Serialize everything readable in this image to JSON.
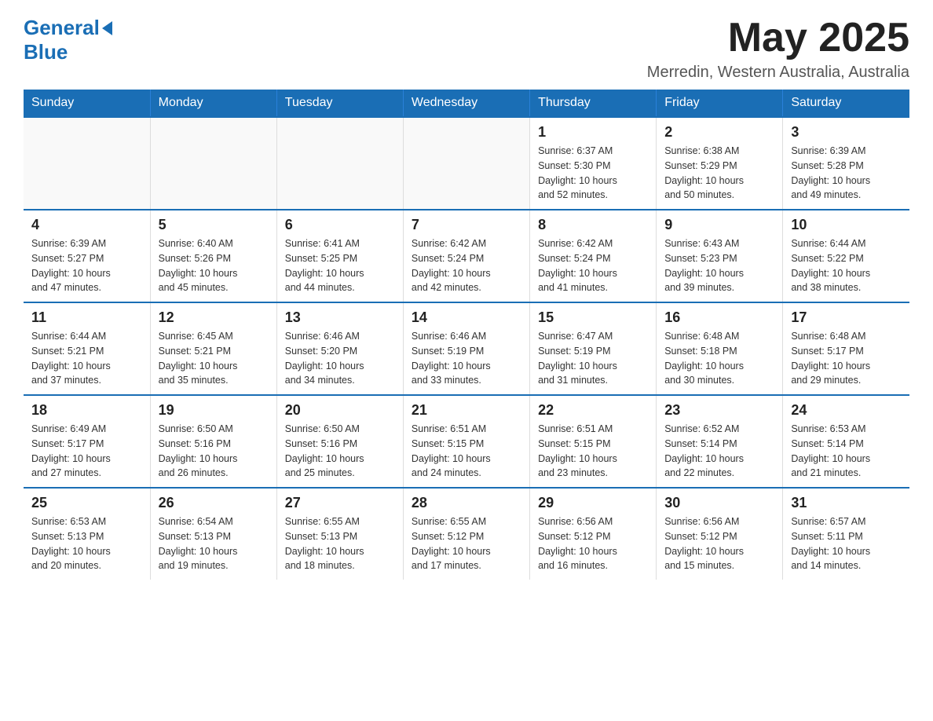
{
  "header": {
    "logo_text1": "General",
    "logo_text2": "Blue",
    "month": "May 2025",
    "location": "Merredin, Western Australia, Australia"
  },
  "weekdays": [
    "Sunday",
    "Monday",
    "Tuesday",
    "Wednesday",
    "Thursday",
    "Friday",
    "Saturday"
  ],
  "weeks": [
    [
      {
        "day": "",
        "info": ""
      },
      {
        "day": "",
        "info": ""
      },
      {
        "day": "",
        "info": ""
      },
      {
        "day": "",
        "info": ""
      },
      {
        "day": "1",
        "info": "Sunrise: 6:37 AM\nSunset: 5:30 PM\nDaylight: 10 hours\nand 52 minutes."
      },
      {
        "day": "2",
        "info": "Sunrise: 6:38 AM\nSunset: 5:29 PM\nDaylight: 10 hours\nand 50 minutes."
      },
      {
        "day": "3",
        "info": "Sunrise: 6:39 AM\nSunset: 5:28 PM\nDaylight: 10 hours\nand 49 minutes."
      }
    ],
    [
      {
        "day": "4",
        "info": "Sunrise: 6:39 AM\nSunset: 5:27 PM\nDaylight: 10 hours\nand 47 minutes."
      },
      {
        "day": "5",
        "info": "Sunrise: 6:40 AM\nSunset: 5:26 PM\nDaylight: 10 hours\nand 45 minutes."
      },
      {
        "day": "6",
        "info": "Sunrise: 6:41 AM\nSunset: 5:25 PM\nDaylight: 10 hours\nand 44 minutes."
      },
      {
        "day": "7",
        "info": "Sunrise: 6:42 AM\nSunset: 5:24 PM\nDaylight: 10 hours\nand 42 minutes."
      },
      {
        "day": "8",
        "info": "Sunrise: 6:42 AM\nSunset: 5:24 PM\nDaylight: 10 hours\nand 41 minutes."
      },
      {
        "day": "9",
        "info": "Sunrise: 6:43 AM\nSunset: 5:23 PM\nDaylight: 10 hours\nand 39 minutes."
      },
      {
        "day": "10",
        "info": "Sunrise: 6:44 AM\nSunset: 5:22 PM\nDaylight: 10 hours\nand 38 minutes."
      }
    ],
    [
      {
        "day": "11",
        "info": "Sunrise: 6:44 AM\nSunset: 5:21 PM\nDaylight: 10 hours\nand 37 minutes."
      },
      {
        "day": "12",
        "info": "Sunrise: 6:45 AM\nSunset: 5:21 PM\nDaylight: 10 hours\nand 35 minutes."
      },
      {
        "day": "13",
        "info": "Sunrise: 6:46 AM\nSunset: 5:20 PM\nDaylight: 10 hours\nand 34 minutes."
      },
      {
        "day": "14",
        "info": "Sunrise: 6:46 AM\nSunset: 5:19 PM\nDaylight: 10 hours\nand 33 minutes."
      },
      {
        "day": "15",
        "info": "Sunrise: 6:47 AM\nSunset: 5:19 PM\nDaylight: 10 hours\nand 31 minutes."
      },
      {
        "day": "16",
        "info": "Sunrise: 6:48 AM\nSunset: 5:18 PM\nDaylight: 10 hours\nand 30 minutes."
      },
      {
        "day": "17",
        "info": "Sunrise: 6:48 AM\nSunset: 5:17 PM\nDaylight: 10 hours\nand 29 minutes."
      }
    ],
    [
      {
        "day": "18",
        "info": "Sunrise: 6:49 AM\nSunset: 5:17 PM\nDaylight: 10 hours\nand 27 minutes."
      },
      {
        "day": "19",
        "info": "Sunrise: 6:50 AM\nSunset: 5:16 PM\nDaylight: 10 hours\nand 26 minutes."
      },
      {
        "day": "20",
        "info": "Sunrise: 6:50 AM\nSunset: 5:16 PM\nDaylight: 10 hours\nand 25 minutes."
      },
      {
        "day": "21",
        "info": "Sunrise: 6:51 AM\nSunset: 5:15 PM\nDaylight: 10 hours\nand 24 minutes."
      },
      {
        "day": "22",
        "info": "Sunrise: 6:51 AM\nSunset: 5:15 PM\nDaylight: 10 hours\nand 23 minutes."
      },
      {
        "day": "23",
        "info": "Sunrise: 6:52 AM\nSunset: 5:14 PM\nDaylight: 10 hours\nand 22 minutes."
      },
      {
        "day": "24",
        "info": "Sunrise: 6:53 AM\nSunset: 5:14 PM\nDaylight: 10 hours\nand 21 minutes."
      }
    ],
    [
      {
        "day": "25",
        "info": "Sunrise: 6:53 AM\nSunset: 5:13 PM\nDaylight: 10 hours\nand 20 minutes."
      },
      {
        "day": "26",
        "info": "Sunrise: 6:54 AM\nSunset: 5:13 PM\nDaylight: 10 hours\nand 19 minutes."
      },
      {
        "day": "27",
        "info": "Sunrise: 6:55 AM\nSunset: 5:13 PM\nDaylight: 10 hours\nand 18 minutes."
      },
      {
        "day": "28",
        "info": "Sunrise: 6:55 AM\nSunset: 5:12 PM\nDaylight: 10 hours\nand 17 minutes."
      },
      {
        "day": "29",
        "info": "Sunrise: 6:56 AM\nSunset: 5:12 PM\nDaylight: 10 hours\nand 16 minutes."
      },
      {
        "day": "30",
        "info": "Sunrise: 6:56 AM\nSunset: 5:12 PM\nDaylight: 10 hours\nand 15 minutes."
      },
      {
        "day": "31",
        "info": "Sunrise: 6:57 AM\nSunset: 5:11 PM\nDaylight: 10 hours\nand 14 minutes."
      }
    ]
  ]
}
